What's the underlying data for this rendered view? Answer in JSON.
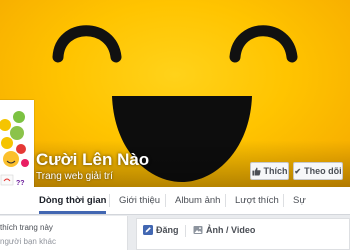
{
  "page": {
    "name": "Cười Lên Nào",
    "category": "Trang web giải trí"
  },
  "actions": {
    "like_label": "Thích",
    "follow_label": "Theo dõi"
  },
  "tabs": [
    {
      "label": "Dòng thời gian",
      "active": true
    },
    {
      "label": "Giới thiệu",
      "active": false
    },
    {
      "label": "Album ảnh",
      "active": false
    },
    {
      "label": "Lượt thích",
      "active": false
    },
    {
      "label": "Sự",
      "active": false
    }
  ],
  "sidebar": {
    "likes_text": "thích trang này",
    "others_text": "người bạn khác"
  },
  "composer": {
    "post_label": "Đăng",
    "photo_video_label": "Ảnh / Video"
  },
  "colors": {
    "cover_yellow": "#ffc400",
    "accent_blue": "#4267b2"
  }
}
